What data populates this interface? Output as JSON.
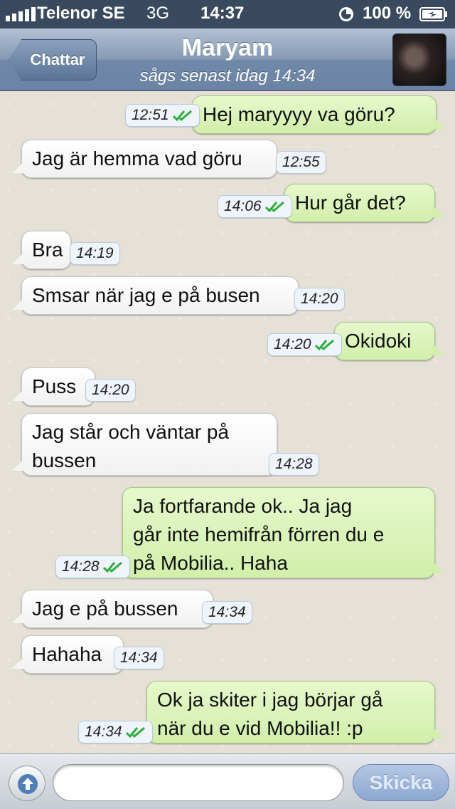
{
  "status_bar": {
    "carrier": "Telenor SE",
    "network": "3G",
    "time": "14:37",
    "battery": "100 %",
    "icons": [
      "signal-icon",
      "orientation-lock-icon",
      "battery-charging-icon"
    ]
  },
  "nav": {
    "back_label": "Chattar",
    "title": "Maryam",
    "subtitle": "sågs senast idag 14:34"
  },
  "messages": [
    {
      "dir": "out",
      "text": "Hej maryyyy va göru?",
      "time": "12:51",
      "read": true
    },
    {
      "dir": "in",
      "text": "Jag är hemma vad göru",
      "time": "12:55"
    },
    {
      "dir": "out",
      "text": "Hur går det?",
      "time": "14:06",
      "read": true
    },
    {
      "dir": "in",
      "text": "Bra",
      "time": "14:19"
    },
    {
      "dir": "in",
      "text": "Smsar när jag e på busen",
      "time": "14:20"
    },
    {
      "dir": "out",
      "text": "Okidoki",
      "time": "14:20",
      "read": true
    },
    {
      "dir": "in",
      "text": "Puss",
      "time": "14:20"
    },
    {
      "dir": "in",
      "text": "Jag står och väntar på\nbussen",
      "time": "14:28"
    },
    {
      "dir": "out",
      "text": "Ja fortfarande ok.. Ja jag\ngår inte hemifrån förren du e\npå Mobilia.. Haha",
      "time": "14:28",
      "read": true
    },
    {
      "dir": "in",
      "text": "Jag e på bussen",
      "time": "14:34"
    },
    {
      "dir": "in",
      "text": "Hahaha",
      "time": "14:34"
    },
    {
      "dir": "out",
      "text": "Ok ja skiter i jag börjar gå\nnär du e vid Mobilia!! :p",
      "time": "14:34",
      "read": true
    }
  ],
  "input": {
    "placeholder": "",
    "send_label": "Skicka"
  },
  "colors": {
    "outgoing_bubble": "#dcf4bf",
    "incoming_bubble": "#ffffff",
    "read_check": "#2fae3a",
    "navbar": "#6c84a4"
  }
}
